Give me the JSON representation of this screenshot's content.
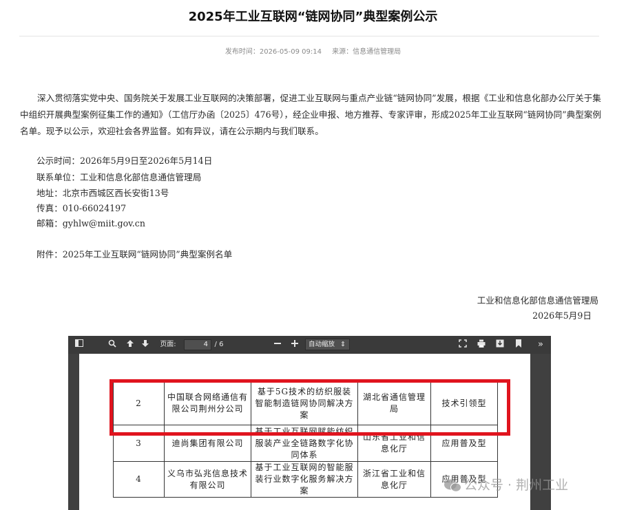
{
  "article": {
    "title": "2025年工业互联网“链网协同”典型案例公示",
    "publish_label": "发布时间：2026-05-09 09:14",
    "source_label": "来源：信息通信管理局",
    "intro": "深入贯彻落实党中央、国务院关于发展工业互联网的决策部署，促进工业互联网与重点产业链“链网协同”发展，根据《工业和信息化部办公厅关于集中组织开展典型案例征集工作的通知》（工信厅办函〔2025〕476号），经企业申报、地方推荐、专家评审，形成2025年工业互联网“链网协同”典型案例名单。现予以公示，欢迎社会各界监督。如有异议，请在公示期内与我们联系。",
    "info": {
      "period": "公示时间：2026年5月9日至2026年5月14日",
      "contact_unit": "联系单位：工业和信息化部信息通信管理局",
      "address": "地址：北京市西城区西长安街13号",
      "fax": "传真：010-66024197",
      "email": "邮箱：gyhlw@miit.gov.cn"
    },
    "attachment": "附件：2025年工业互联网“链网协同”典型案例名单",
    "sign_org": "工业和信息化部信息通信管理局",
    "sign_date": "2026年5月9日"
  },
  "viewer": {
    "page_label": "页面:",
    "page_current": "4",
    "page_total": "/ 6",
    "zoom": "自动缩放",
    "zoom_arrow": "⇕",
    "icons": [
      "sidebar-toggle-icon",
      "find-icon",
      "previous-page-icon",
      "next-page-icon",
      "zoom-out-icon",
      "zoom-in-icon",
      "presentation-mode-icon",
      "print-icon",
      "download-icon",
      "bookmark-icon",
      "tools-icon"
    ]
  },
  "table": {
    "rows": [
      {
        "no": "2",
        "company": "中国联合网络通信有限公司荆州分公司",
        "project": "基于5G技术的纺织服装智能制造链网协同解决方案",
        "recommender": "湖北省通信管理局",
        "type": "技术引领型"
      },
      {
        "no": "3",
        "company": "迪尚集团有限公司",
        "project": "基于工业互联网赋能纺织服装产业全链路数字化协同体系",
        "recommender": "山东省工业和信息化厅",
        "type": "应用普及型"
      },
      {
        "no": "4",
        "company": "义乌市弘兆信息技术有限公司",
        "project": "基于工业互联网的智能服装行业数字化服务解决方案",
        "recommender": "浙江省工业和信息化厅",
        "type": "应用普及型"
      }
    ]
  },
  "watermark": {
    "text": "公众号 · 荆州工业"
  },
  "colors": {
    "highlight_border": "#e0141e",
    "viewer_bg": "#404040",
    "toolbar_bg": "#3a3a3a"
  }
}
